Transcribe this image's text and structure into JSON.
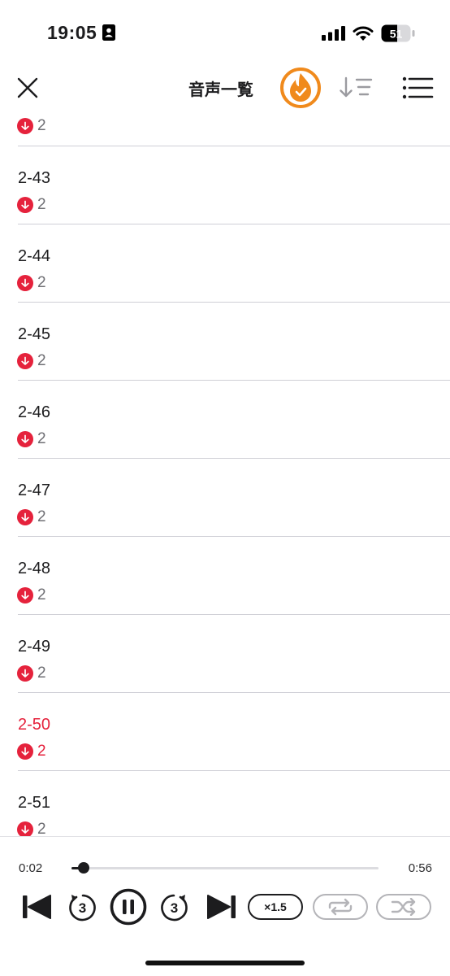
{
  "status_bar": {
    "time": "19:05",
    "battery": "51"
  },
  "header": {
    "title": "音声一覧"
  },
  "list": {
    "top_partial": {
      "count": "2"
    },
    "items": [
      {
        "title": "2-43",
        "count": "2"
      },
      {
        "title": "2-44",
        "count": "2"
      },
      {
        "title": "2-45",
        "count": "2"
      },
      {
        "title": "2-46",
        "count": "2"
      },
      {
        "title": "2-47",
        "count": "2"
      },
      {
        "title": "2-48",
        "count": "2"
      },
      {
        "title": "2-49",
        "count": "2"
      },
      {
        "title": "2-50",
        "count": "2",
        "active": true
      },
      {
        "title": "2-51",
        "count": "2"
      }
    ]
  },
  "player": {
    "elapsed": "0:02",
    "total": "0:56",
    "progress": 0.04,
    "skip_back_seconds": "3",
    "skip_forward_seconds": "3",
    "speed": "×1.5",
    "state": "playing"
  },
  "colors": {
    "accent": "#e5223c",
    "flame": "#f08a1c",
    "text": "#1c1c1e",
    "muted": "#b4b4b8"
  },
  "icons": {
    "header": [
      "close-icon",
      "flame-icon",
      "sort-icon",
      "menu-icon"
    ],
    "player": [
      "skip-previous-icon",
      "rewind-3-icon",
      "pause-icon",
      "forward-3-icon",
      "skip-next-icon",
      "repeat-icon",
      "shuffle-icon"
    ]
  }
}
